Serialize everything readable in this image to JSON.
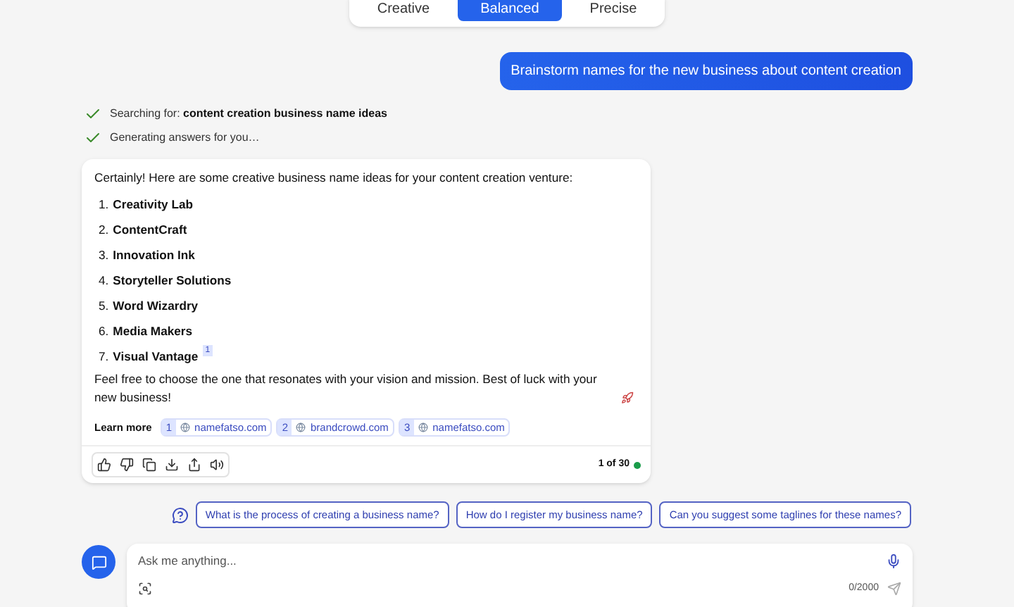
{
  "tone_tabs": [
    {
      "label": "Creative",
      "selected": false
    },
    {
      "label": "Balanced",
      "selected": true
    },
    {
      "label": "Precise",
      "selected": false
    }
  ],
  "user_message": "Brainstorm names for the new business about content creation",
  "progress": [
    {
      "label": "Searching for:",
      "query": "content creation business name ideas",
      "done": true
    },
    {
      "label": "Generating answers for you…",
      "done": true
    }
  ],
  "answer": {
    "intro": "Certainly! Here are some creative business name ideas for your content creation venture:",
    "items": [
      {
        "number": "1.",
        "name": "Creativity Lab"
      },
      {
        "number": "2.",
        "name": "ContentCraft"
      },
      {
        "number": "3.",
        "name": "Innovation Ink"
      },
      {
        "number": "4.",
        "name": "Storyteller Solutions"
      },
      {
        "number": "5.",
        "name": "Word Wizardry"
      },
      {
        "number": "6.",
        "name": "Media Makers"
      },
      {
        "number": "7.",
        "name": "Visual Vantage",
        "citation": "1"
      }
    ],
    "outro": "Feel free to choose the one that resonates with your vision and mission. Best of luck with your new business!",
    "learn_more_label": "Learn more",
    "sources": [
      {
        "number": "1",
        "domain": "namefatso.com"
      },
      {
        "number": "2",
        "domain": "brandcrowd.com"
      },
      {
        "number": "3",
        "domain": "namefatso.com"
      }
    ],
    "page_count": "1 of 30"
  },
  "suggestions": [
    "What is the process of creating a business name?",
    "How do I register my business name?",
    "Can you suggest some taglines for these names?"
  ],
  "input": {
    "placeholder": "Ask me anything...",
    "counter": "0/2000"
  }
}
